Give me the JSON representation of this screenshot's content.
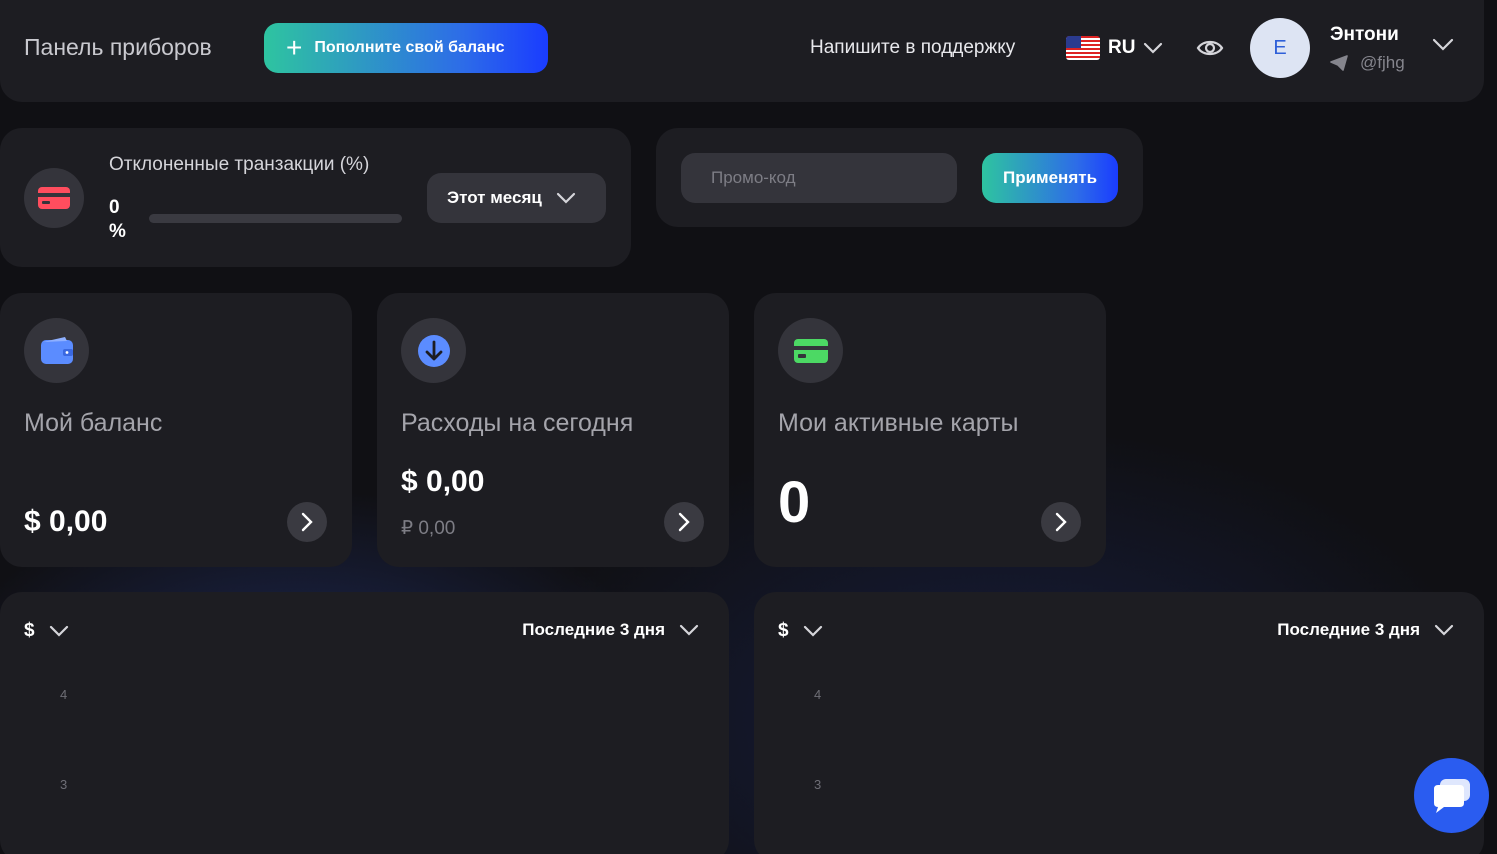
{
  "header": {
    "title": "Панель приборов",
    "topup_label": "Пополните свой баланс",
    "support_label": "Напишите в поддержку",
    "language_code": "RU",
    "user": {
      "avatar_letter": "E",
      "name": "Энтони",
      "handle": "@fjhg"
    }
  },
  "declined": {
    "title": "Отклоненные транзакции (%)",
    "value": "0",
    "unit": "%",
    "progress_fraction": 0,
    "period_label": "Этот месяц"
  },
  "promo": {
    "placeholder": "Промо-код",
    "apply_label": "Применять"
  },
  "stats": [
    {
      "label": "Мой баланс",
      "amount": "$ 0,00",
      "icon": "wallet-icon",
      "icon_color": "#5b8cff"
    },
    {
      "label": "Расходы на сегодня",
      "amount": "$ 0,00",
      "sub": "₽ 0,00",
      "icon": "download-arrow-icon",
      "icon_color": "#5b8cff"
    },
    {
      "label": "Мои активные карты",
      "amount": "0",
      "icon": "card-icon",
      "icon_color": "#4cd964"
    }
  ],
  "charts": [
    {
      "currency": "$",
      "range_label": "Последние 3 дня",
      "y_ticks": [
        "4",
        "3"
      ]
    },
    {
      "currency": "$",
      "range_label": "Последние 3 дня",
      "y_ticks": [
        "4",
        "3"
      ]
    }
  ],
  "colors": {
    "accent_gradient_start": "#2ec4a0",
    "accent_gradient_end": "#1a3cff",
    "declined_icon": "#ff4d5e"
  }
}
